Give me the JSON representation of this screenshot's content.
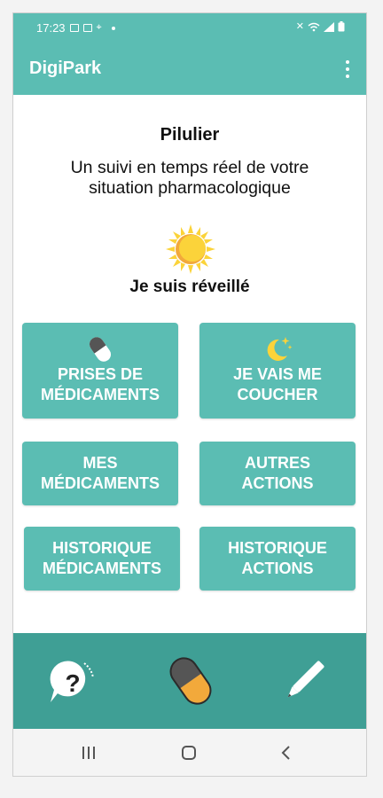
{
  "status_bar": {
    "time": "17:23",
    "left_icons": [
      "image-icon",
      "message-icon",
      "location-icon",
      "dot-icon"
    ],
    "right_icons": [
      "mute-icon",
      "wifi-icon",
      "signal-icon",
      "battery-icon"
    ]
  },
  "app_bar": {
    "title": "DigiPark",
    "menu_icon": "more-vert-icon"
  },
  "content": {
    "title": "Pilulier",
    "subtitle_line1": "Un suivi en temps réel de votre",
    "subtitle_line2": "situation pharmacologique",
    "state_icon": "sun-icon",
    "state_label": "Je suis réveillé"
  },
  "tiles": {
    "prises": {
      "line1": "PRISES DE",
      "line2": "MÉDICAMENTS",
      "icon": "pill-icon"
    },
    "coucher": {
      "line1": "JE VAIS ME",
      "line2": "COUCHER",
      "icon": "moon-stars-icon"
    },
    "mes_medicaments": {
      "line1": "MES",
      "line2": "MÉDICAMENTS"
    },
    "autres_actions": {
      "line1": "AUTRES",
      "line2": "ACTIONS"
    },
    "historique_medicaments": {
      "line1": "HISTORIQUE",
      "line2": "MÉDICAMENTS"
    },
    "historique_actions": {
      "line1": "HISTORIQUE",
      "line2": "ACTIONS"
    }
  },
  "bottom_bar": {
    "items": [
      "help-icon",
      "pill-icon",
      "pencil-icon"
    ]
  },
  "nav_bar": {
    "items": [
      "recent-apps-icon",
      "home-icon",
      "back-icon"
    ]
  },
  "colors": {
    "primary": "#5bbdb3",
    "primary_dark": "#3f9f95",
    "pill_orange": "#f2a93b",
    "sun_yellow": "#fbd33a"
  }
}
